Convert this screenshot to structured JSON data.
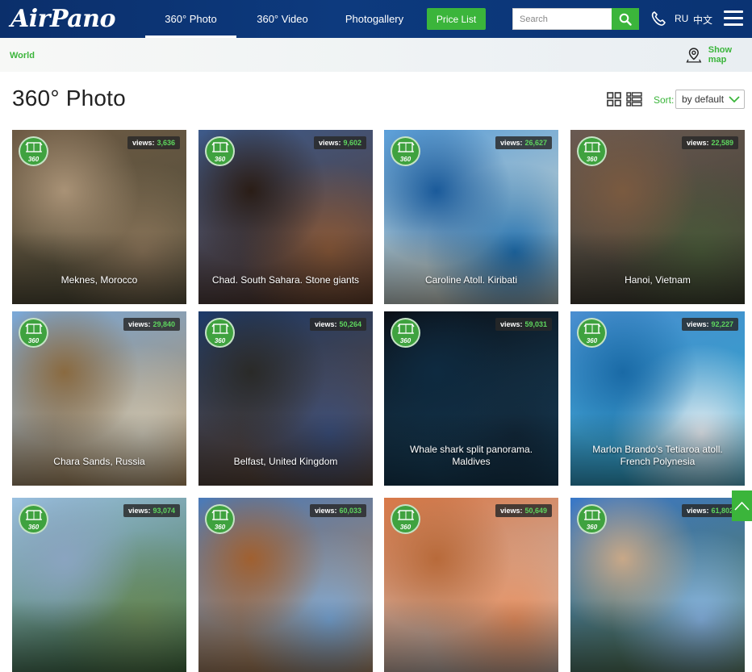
{
  "header": {
    "logo": "AirPano",
    "nav": [
      {
        "label": "360° Photo",
        "active": true
      },
      {
        "label": "360° Video",
        "active": false
      },
      {
        "label": "Photogallery",
        "active": false
      }
    ],
    "price_button": "Price List",
    "search_placeholder": "Search",
    "languages": [
      "RU",
      "中文"
    ]
  },
  "breadcrumb": {
    "root": "World",
    "show_map": "Show map"
  },
  "page": {
    "title": "360° Photo",
    "sort_label": "Sort:",
    "sort_value": "by default"
  },
  "views_label": "views:",
  "badge_text": "360",
  "cards": [
    {
      "title": "Meknes, Morocco",
      "views": "3,636",
      "palette": [
        "#6d5a44",
        "#8a7459",
        "#4e4c38",
        "#a99276"
      ]
    },
    {
      "title": "Chad. South Sahara. Stone giants",
      "views": "9,602",
      "palette": [
        "#3d5a8a",
        "#8a5a3a",
        "#5a3826",
        "#2a1d16"
      ]
    },
    {
      "title": "Caroline Atoll. Kiribati",
      "views": "26,627",
      "palette": [
        "#5a9ed8",
        "#1f6fb0",
        "#e8e0c8",
        "#1a5a9a"
      ]
    },
    {
      "title": "Hanoi, Vietnam",
      "views": "22,589",
      "palette": [
        "#6a5a52",
        "#4a5a3a",
        "#3a3a2e",
        "#7a5a40"
      ]
    },
    {
      "title": "Chara Sands, Russia",
      "views": "29,840",
      "palette": [
        "#7aa8d8",
        "#c9c4b4",
        "#b88a4e",
        "#8a6a40"
      ]
    },
    {
      "title": "Belfast, United Kingdom",
      "views": "50,264",
      "palette": [
        "#1c3a6a",
        "#3a4e7a",
        "#6a4a30",
        "#2a2a28"
      ]
    },
    {
      "title": "Whale shark split panorama. Maldives",
      "views": "59,031",
      "palette": [
        "#0a0f16",
        "#12283a",
        "#1a4a6a",
        "#0e2a40"
      ]
    },
    {
      "title": "Marlon Brando's Tetiaroa atoll. French Polynesia",
      "views": "92,227",
      "palette": [
        "#4a8ed0",
        "#e6ecf2",
        "#2aa6c8",
        "#1a6aa6"
      ]
    },
    {
      "title": "",
      "views": "93,074",
      "palette": [
        "#9ac0e0",
        "#6a8a5a",
        "#3a6a3a",
        "#8aa4c0"
      ]
    },
    {
      "title": "",
      "views": "60,033",
      "palette": [
        "#4a7ab8",
        "#7aa8d8",
        "#c8884a",
        "#a06030"
      ]
    },
    {
      "title": "",
      "views": "50,649",
      "palette": [
        "#d87848",
        "#e89060",
        "#c8c8c8",
        "#b86a3a"
      ]
    },
    {
      "title": "",
      "views": "61,802",
      "palette": [
        "#3a78c8",
        "#8ab8e8",
        "#5a7a4a",
        "#c8a888"
      ]
    }
  ],
  "colors": {
    "header_bg": "#0d3a7e",
    "accent": "#3bb53b"
  }
}
